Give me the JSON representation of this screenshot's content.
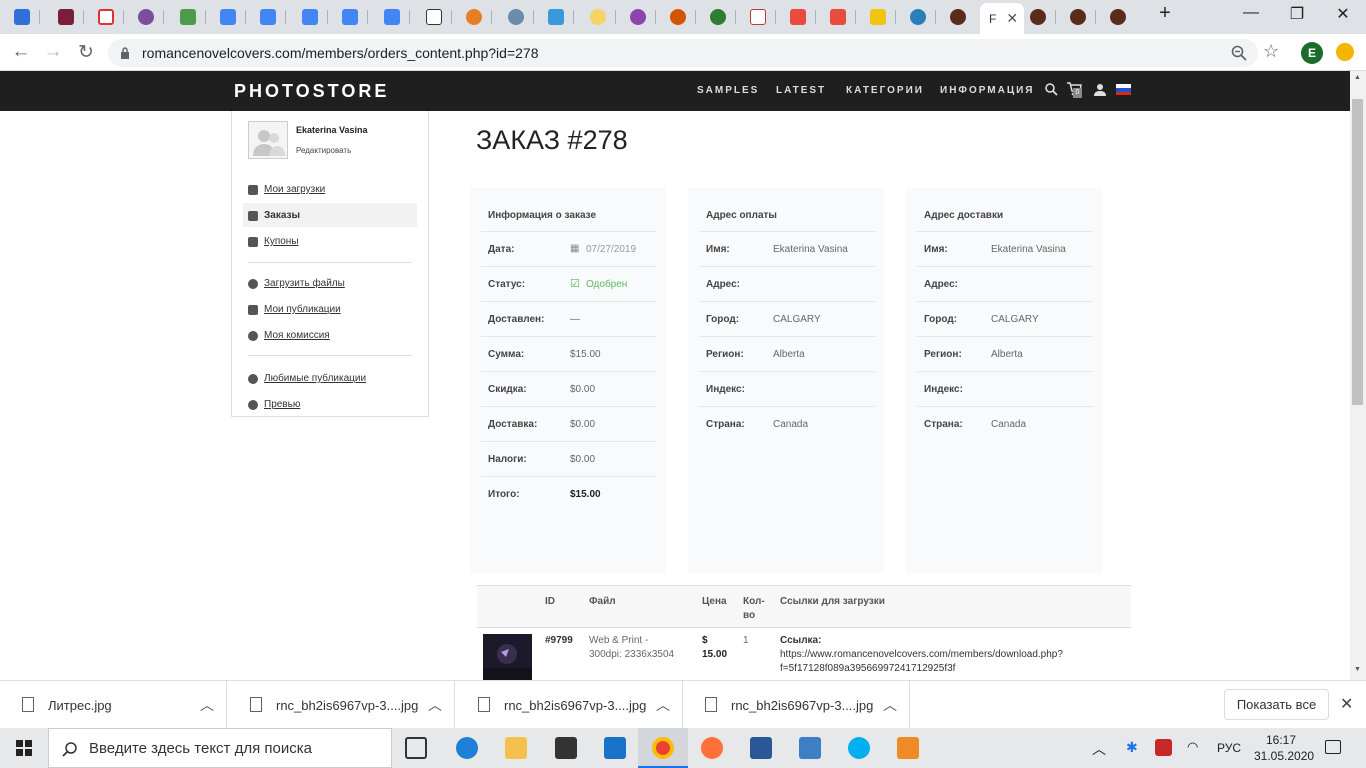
{
  "browser": {
    "active_tab_label": "F",
    "url": "romancenovelcovers.com/members/orders_content.php?id=278",
    "profile_initial": "E"
  },
  "site": {
    "logo": "PHOTOSTORE",
    "nav": [
      "SAMPLES",
      "LATEST",
      "КАТЕГОРИИ",
      "ИНФОРМАЦИЯ"
    ],
    "cart_count": "0"
  },
  "sidebar": {
    "user_name": "Ekaterina Vasina",
    "edit_link": "Редактировать",
    "items": [
      {
        "label": "Мои загрузки"
      },
      {
        "label": "Заказы"
      },
      {
        "label": "Купоны"
      },
      {
        "label": "Загрузить файлы"
      },
      {
        "label": "Мои публикации"
      },
      {
        "label": "Моя комиссия"
      },
      {
        "label": "Любимые публикации"
      },
      {
        "label": "Превью"
      }
    ]
  },
  "order": {
    "title": "ЗАКАЗ #278",
    "info": {
      "heading": "Информация о заказе",
      "rows": [
        {
          "label": "Дата:",
          "value": "07/27/2019"
        },
        {
          "label": "Статус:",
          "value": "Одобрен"
        },
        {
          "label": "Доставлен:",
          "value": "—"
        },
        {
          "label": "Сумма:",
          "value": "$15.00"
        },
        {
          "label": "Скидка:",
          "value": "$0.00"
        },
        {
          "label": "Доставка:",
          "value": "$0.00"
        },
        {
          "label": "Налоги:",
          "value": "$0.00"
        },
        {
          "label": "Итого:",
          "value": "$15.00"
        }
      ]
    },
    "billing": {
      "heading": "Адрес оплаты",
      "rows": [
        {
          "label": "Имя:",
          "value": "Ekaterina Vasina"
        },
        {
          "label": "Адрес:",
          "value": ""
        },
        {
          "label": "Город:",
          "value": "CALGARY"
        },
        {
          "label": "Регион:",
          "value": "Alberta"
        },
        {
          "label": "Индекс:",
          "value": ""
        },
        {
          "label": "Страна:",
          "value": "Canada"
        }
      ]
    },
    "shipping": {
      "heading": "Адрес доставки",
      "rows": [
        {
          "label": "Имя:",
          "value": "Ekaterina Vasina"
        },
        {
          "label": "Адрес:",
          "value": ""
        },
        {
          "label": "Город:",
          "value": "CALGARY"
        },
        {
          "label": "Регион:",
          "value": "Alberta"
        },
        {
          "label": "Индекс:",
          "value": ""
        },
        {
          "label": "Страна:",
          "value": "Canada"
        }
      ]
    }
  },
  "items_table": {
    "headers": {
      "id": "ID",
      "file": "Файл",
      "price": "Цена",
      "qty1": "Кол-",
      "qty2": "во",
      "links": "Ссылки для загрузки"
    },
    "row": {
      "id": "#9799",
      "file1": "Web & Print -",
      "file2": "300dpi: 2336x3504",
      "price1": "$",
      "price2": "15.00",
      "qty": "1",
      "link_label": "Ссылка:",
      "link1": "https://www.romancenovelcovers.com/members/download.php?",
      "link2": "f=5f17128f089a39566997241712925f3f"
    }
  },
  "downloads": {
    "files": [
      "Литрес.jpg",
      "rnc_bh2is6967vp-3....jpg",
      "rnc_bh2is6967vp-3....jpg",
      "rnc_bh2is6967vp-3....jpg"
    ],
    "show_all": "Показать все"
  },
  "taskbar": {
    "search_placeholder": "Введите здесь текст для поиска",
    "lang": "РУС",
    "time": "16:17",
    "date": "31.05.2020"
  },
  "colors": {
    "header_bg": "#1f1f1f",
    "status_green": "#5cb85c",
    "taskbar_bg": "#e7e8ea"
  }
}
